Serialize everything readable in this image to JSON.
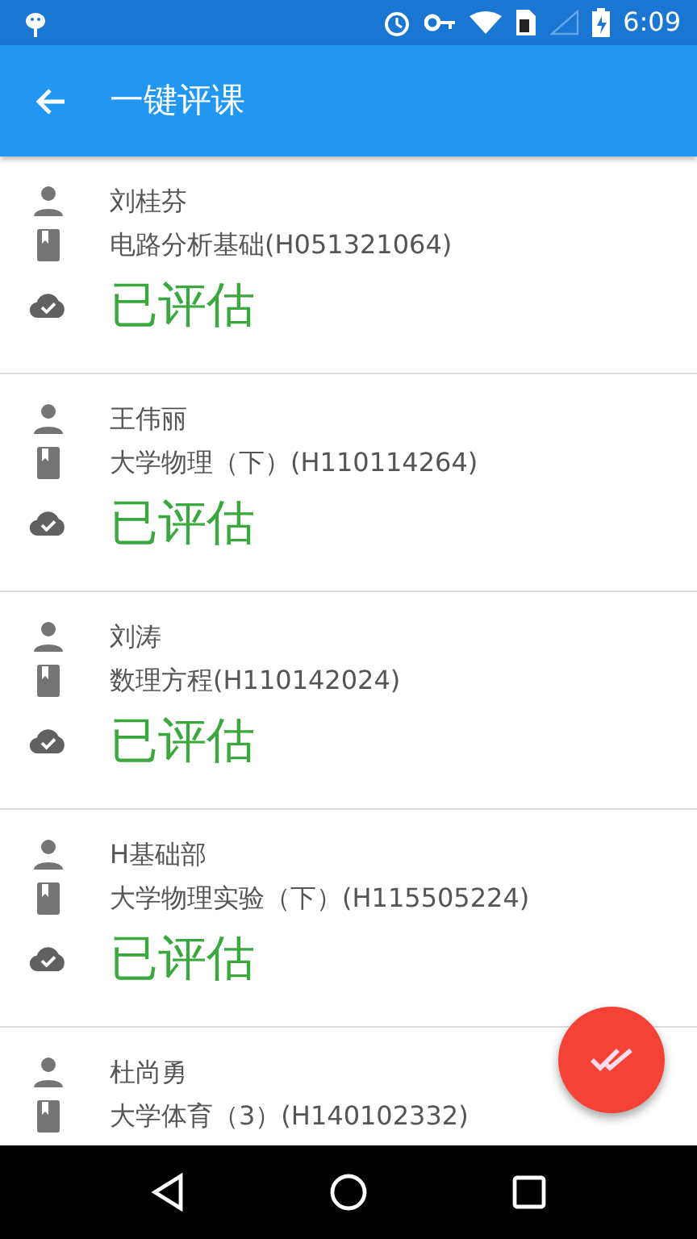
{
  "status_bar": {
    "time": "6:09"
  },
  "app_bar": {
    "title": "一键评课"
  },
  "evaluations": [
    {
      "teacher": "刘桂芬",
      "course": "电路分析基础(H051321064)",
      "status": "已评估"
    },
    {
      "teacher": "王伟丽",
      "course": "大学物理（下）(H110114264)",
      "status": "已评估"
    },
    {
      "teacher": "刘涛",
      "course": "数理方程(H110142024)",
      "status": "已评估"
    },
    {
      "teacher": "H基础部",
      "course": "大学物理实验（下）(H115505224)",
      "status": "已评估"
    },
    {
      "teacher": "杜尚勇",
      "course": "大学体育（3）(H140102332)"
    }
  ]
}
